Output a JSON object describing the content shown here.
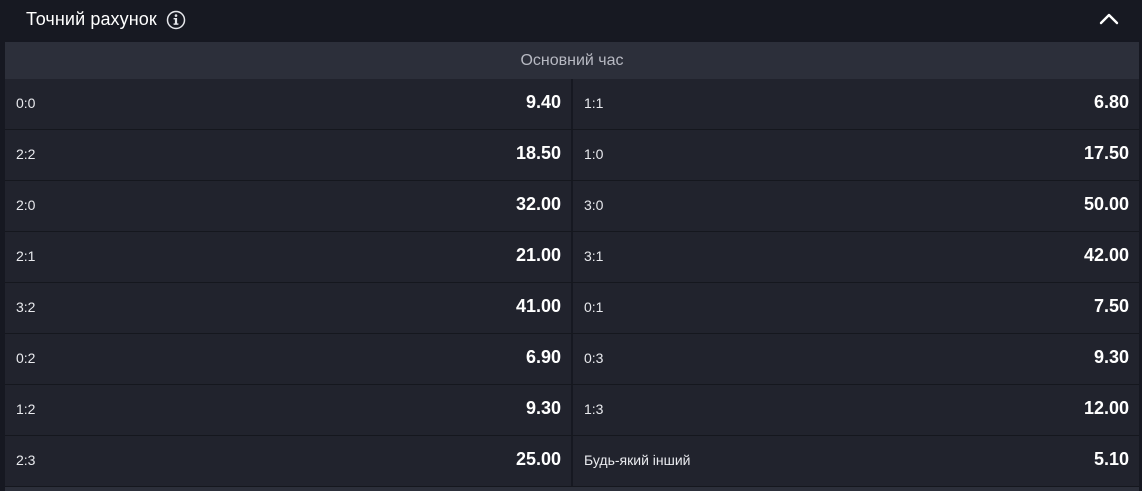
{
  "market": {
    "title": "Точний рахунок",
    "info_icon": "info-icon",
    "collapse_icon": "chevron-up-icon",
    "period": "Основний час"
  },
  "outcomes": {
    "rows": [
      {
        "left": {
          "label": "0:0",
          "odds": "9.40"
        },
        "right": {
          "label": "1:1",
          "odds": "6.80"
        }
      },
      {
        "left": {
          "label": "2:2",
          "odds": "18.50"
        },
        "right": {
          "label": "1:0",
          "odds": "17.50"
        }
      },
      {
        "left": {
          "label": "2:0",
          "odds": "32.00"
        },
        "right": {
          "label": "3:0",
          "odds": "50.00"
        }
      },
      {
        "left": {
          "label": "2:1",
          "odds": "21.00"
        },
        "right": {
          "label": "3:1",
          "odds": "42.00"
        }
      },
      {
        "left": {
          "label": "3:2",
          "odds": "41.00"
        },
        "right": {
          "label": "0:1",
          "odds": "7.50"
        }
      },
      {
        "left": {
          "label": "0:2",
          "odds": "6.90"
        },
        "right": {
          "label": "0:3",
          "odds": "9.30"
        }
      },
      {
        "left": {
          "label": "1:2",
          "odds": "9.30"
        },
        "right": {
          "label": "1:3",
          "odds": "12.00"
        }
      },
      {
        "left": {
          "label": "2:3",
          "odds": "25.00"
        },
        "right": {
          "label": "Будь-який інший",
          "odds": "5.10"
        }
      }
    ]
  },
  "colors": {
    "background": "#161821",
    "cell": "#21232d",
    "subheader": "#2c2f3a",
    "text": "#ffffff",
    "muted_text": "#b7b9c2"
  }
}
